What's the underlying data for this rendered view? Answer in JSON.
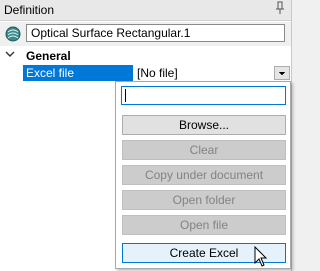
{
  "panel": {
    "title": "Definition",
    "pin_icon": "pin-icon",
    "object_icon": "optical-surface-icon",
    "object_name": "Optical Surface Rectangular.1"
  },
  "tree": {
    "group_chevron_icon": "chevron-down-icon",
    "group_label": "General",
    "property": {
      "name": "Excel file",
      "value": "[No file]",
      "dropdown_icon": "dropdown-arrow-icon"
    }
  },
  "popup": {
    "input_value": "",
    "buttons": [
      {
        "label": "Browse...",
        "enabled": true
      },
      {
        "label": "Clear",
        "enabled": false
      },
      {
        "label": "Copy under document",
        "enabled": false
      },
      {
        "label": "Open folder",
        "enabled": false
      },
      {
        "label": "Open file",
        "enabled": false
      },
      {
        "label": "Create Excel",
        "enabled": true
      }
    ]
  },
  "colors": {
    "selection": "#0078d7",
    "disabled_button": "#cccccc",
    "enabled_button": "#e1e1e1"
  },
  "cursor_icon": "mouse-pointer-icon"
}
